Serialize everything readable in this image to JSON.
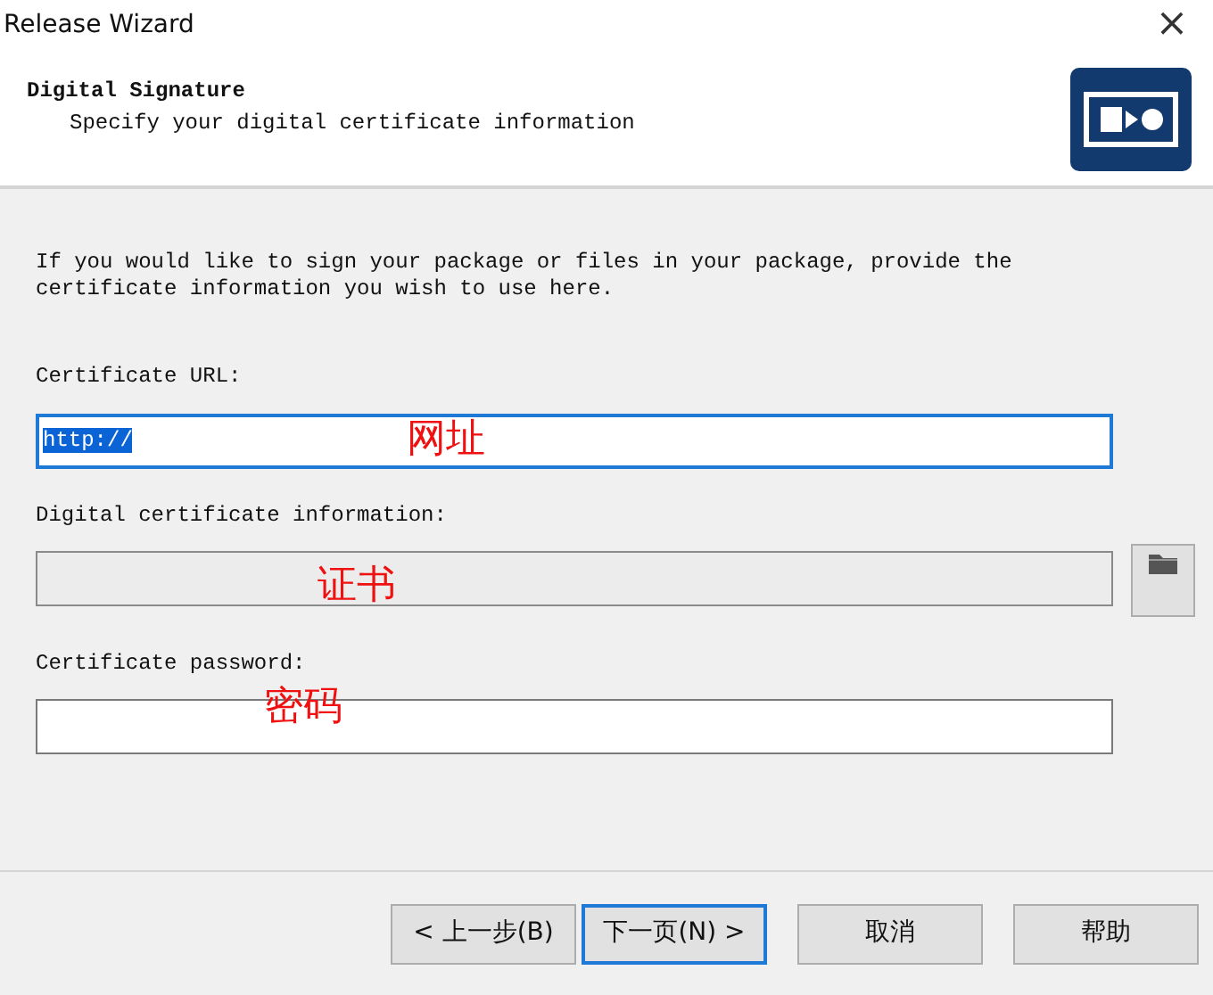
{
  "window": {
    "title": "Release Wizard",
    "close_glyph": "×"
  },
  "header": {
    "title": "Digital Signature",
    "subtitle": "Specify your digital certificate information"
  },
  "intro": "If you would like to sign your package or files in your package, provide the certificate information you wish to use here.",
  "fields": [
    {
      "label": "Certificate URL:",
      "value": "http://",
      "text_selected": true,
      "focused": true,
      "disabled": false,
      "annotation": "网址"
    },
    {
      "label": "Digital certificate information:",
      "focused": false,
      "disabled": true,
      "browse_button": true,
      "annotation": "证书"
    },
    {
      "label": "Certificate password:",
      "focused": false,
      "disabled": false,
      "annotation": "密码"
    }
  ],
  "buttons": [
    {
      "label": "< 上一步(B)",
      "focused": false
    },
    {
      "label": "下一页(N) >",
      "focused": true
    },
    {
      "label": "取消",
      "focused": false
    },
    {
      "label": "帮助",
      "focused": false
    }
  ]
}
